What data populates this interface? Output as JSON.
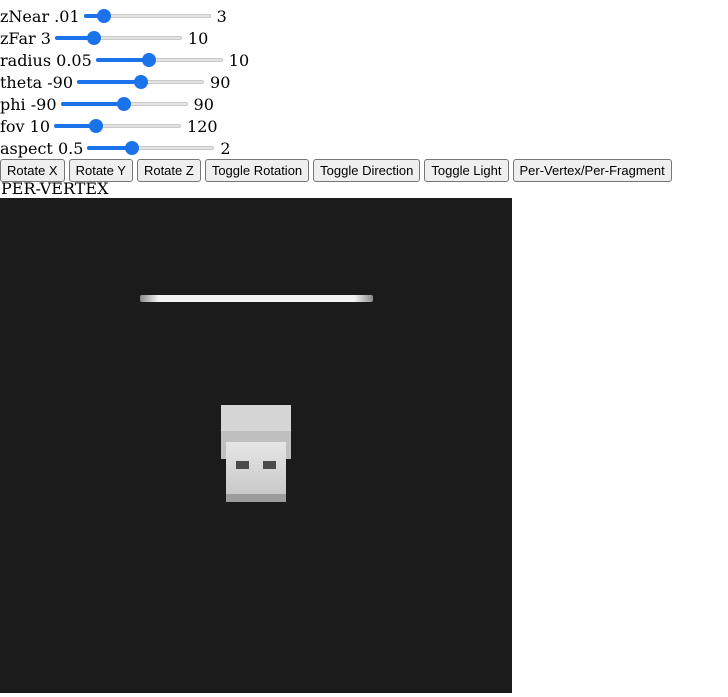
{
  "sliders": [
    {
      "id": "znear",
      "min_label": "zNear .01",
      "max_label": "3",
      "value_fraction": 0.16
    },
    {
      "id": "zfar",
      "min_label": "zFar 3",
      "max_label": "10",
      "value_fraction": 0.31
    },
    {
      "id": "radius",
      "min_label": "radius 0.05",
      "max_label": "10",
      "value_fraction": 0.42
    },
    {
      "id": "theta",
      "min_label": "theta -90",
      "max_label": "90",
      "value_fraction": 0.5
    },
    {
      "id": "phi",
      "min_label": "phi -90",
      "max_label": "90",
      "value_fraction": 0.5
    },
    {
      "id": "fov",
      "min_label": "fov 10",
      "max_label": "120",
      "value_fraction": 0.33
    },
    {
      "id": "aspect",
      "min_label": "aspect 0.5",
      "max_label": "2",
      "value_fraction": 0.35
    }
  ],
  "buttons": {
    "rotate_x": "Rotate X",
    "rotate_y": "Rotate Y",
    "rotate_z": "Rotate Z",
    "toggle_rotation": "Toggle Rotation",
    "toggle_direction": "Toggle Direction",
    "toggle_light": "Toggle Light",
    "shading_mode": "Per-Vertex/Per-Fragment"
  },
  "mode_label": "PER-VERTEX",
  "colors": {
    "accent": "#1a73e8",
    "canvas_bg": "#1b1b1b",
    "object": "#d9d9d9"
  }
}
